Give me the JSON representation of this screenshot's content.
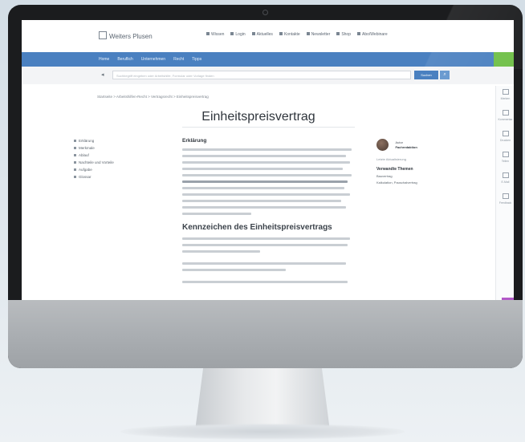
{
  "site": {
    "logo_text": "Weiters Plusen"
  },
  "topnav": [
    "Wissen",
    "Login",
    "Aktuelles",
    "Kontakte",
    "Newsletter",
    "Shop",
    "Abo/Webinare"
  ],
  "bluenav": [
    "Home",
    "Beruflich",
    "Unternehmen",
    "Recht",
    "Tipps"
  ],
  "search": {
    "placeholder": "Suchbegriff eingeben oder Arbeitshilfe, Formular oder Vorlage finden",
    "button": "Suchen",
    "back": "◂",
    "icon": "⌕"
  },
  "breadcrumb": "Startseite  >  Arbeitshilfen-Recht  >  Vertragsrecht  >  Einheitspreisvertrag",
  "page": {
    "title": "Einheitspreisvertrag"
  },
  "toc": [
    "Erklärung",
    "Merkmale",
    "Ablauf",
    "Nachteile und Vorteile",
    "Aufgabe",
    "Glossar"
  ],
  "article": {
    "h_intro": "Erklärung",
    "h_section": "Kennzeichen des Einheitspreisvertrags"
  },
  "author": {
    "label": "Autor",
    "name": "Fachredaktion",
    "meta": "Letzte Aktualisierung"
  },
  "related": {
    "title": "Verwandte Themen",
    "items": [
      "Bauvertrag",
      "Kalkulation, Pauschalvertrag"
    ]
  },
  "rail": [
    "Merken",
    "Kommentar",
    "Drucken",
    "Teilen",
    "E-Mail",
    "Feedback"
  ],
  "colors": {
    "accent_blue": "#4a80c0",
    "accent_green": "#6fbf47"
  }
}
